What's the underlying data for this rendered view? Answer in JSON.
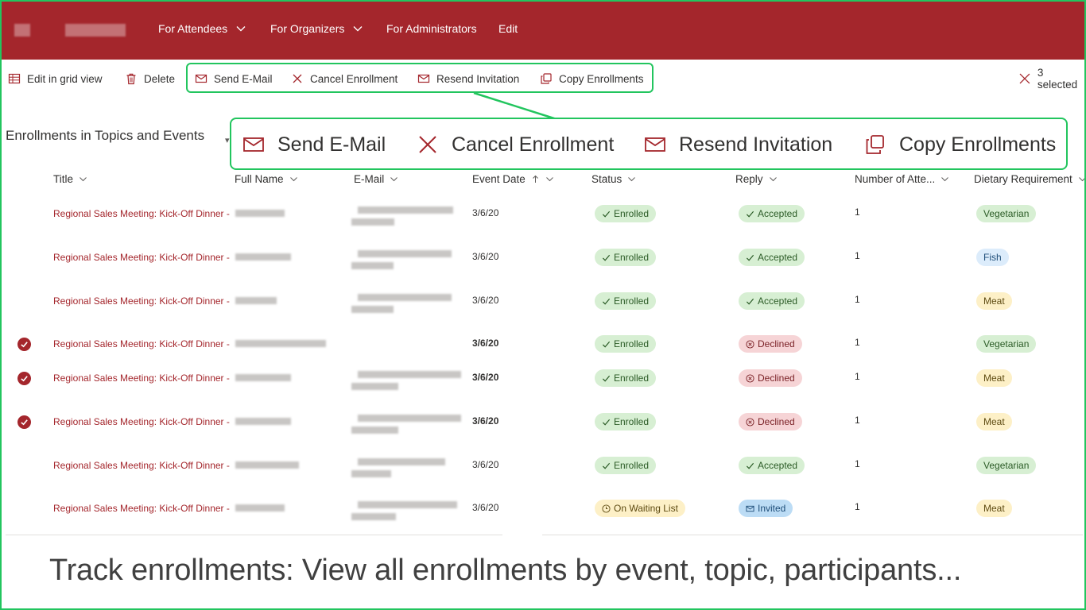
{
  "nav": {
    "items": [
      {
        "label": "For Attendees",
        "has_menu": true
      },
      {
        "label": "For Organizers",
        "has_menu": true
      },
      {
        "label": "For Administrators",
        "has_menu": false
      },
      {
        "label": "Edit",
        "has_menu": false
      }
    ]
  },
  "commands": {
    "edit_grid": "Edit in grid view",
    "delete": "Delete",
    "send_email": "Send E-Mail",
    "cancel_enrollment": "Cancel Enrollment",
    "resend_invitation": "Resend Invitation",
    "copy_enrollments": "Copy Enrollments",
    "selected": "3 selected"
  },
  "zoom": {
    "send_email": "Send E-Mail",
    "cancel_enrollment": "Cancel Enrollment",
    "resend_invitation": "Resend Invitation",
    "copy_enrollments": "Copy Enrollments"
  },
  "list": {
    "title": "Enrollments in Topics and Events",
    "columns": {
      "title": "Title",
      "full_name": "Full Name",
      "email": "E-Mail",
      "event_date": "Event Date",
      "status": "Status",
      "reply": "Reply",
      "attendees": "Number of Atte...",
      "dietary": "Dietary Requirement"
    },
    "rows": [
      {
        "title": "Regional Sales Meeting: Kick-Off Dinner -",
        "date": "3/6/20",
        "status": "Enrolled",
        "reply": "Accepted",
        "count": "1",
        "diet": "Vegetarian",
        "selected": false
      },
      {
        "title": "Regional Sales Meeting: Kick-Off Dinner -",
        "date": "3/6/20",
        "status": "Enrolled",
        "reply": "Accepted",
        "count": "1",
        "diet": "Fish",
        "selected": false
      },
      {
        "title": "Regional Sales Meeting: Kick-Off Dinner -",
        "date": "3/6/20",
        "status": "Enrolled",
        "reply": "Accepted",
        "count": "1",
        "diet": "Meat",
        "selected": false
      },
      {
        "title": "Regional Sales Meeting: Kick-Off Dinner -",
        "date": "3/6/20",
        "status": "Enrolled",
        "reply": "Declined",
        "count": "1",
        "diet": "Vegetarian",
        "selected": true
      },
      {
        "title": "Regional Sales Meeting: Kick-Off Dinner -",
        "date": "3/6/20",
        "status": "Enrolled",
        "reply": "Declined",
        "count": "1",
        "diet": "Meat",
        "selected": true
      },
      {
        "title": "Regional Sales Meeting: Kick-Off Dinner -",
        "date": "3/6/20",
        "status": "Enrolled",
        "reply": "Declined",
        "count": "1",
        "diet": "Meat",
        "selected": true
      },
      {
        "title": "Regional Sales Meeting: Kick-Off Dinner -",
        "date": "3/6/20",
        "status": "Enrolled",
        "reply": "Accepted",
        "count": "1",
        "diet": "Vegetarian",
        "selected": false
      },
      {
        "title": "Regional Sales Meeting: Kick-Off Dinner -",
        "date": "3/6/20",
        "status": "On Waiting List",
        "reply": "Invited",
        "count": "1",
        "diet": "Meat",
        "selected": false
      }
    ]
  },
  "caption": "Track enrollments: View all enrollments by event, topic, participants...",
  "colors": {
    "brand": "#a4262c",
    "highlight": "#22c55e",
    "enrolled_bg": "#d7efd3",
    "declined_bg": "#f6d4d6",
    "waiting_bg": "#fdf0c7",
    "invited_bg": "#bcdcf5",
    "fish_bg": "#dcecfb"
  }
}
